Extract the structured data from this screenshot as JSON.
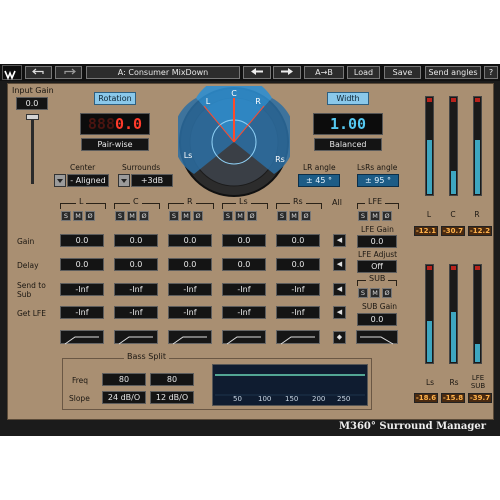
{
  "toolbar": {
    "preset_name": "A: Consumer MixDown",
    "prev_icon": "arrow-left-icon",
    "next_icon": "arrow-right-icon",
    "compare": "A→B",
    "load": "Load",
    "save": "Save",
    "send_angles": "Send angles",
    "help": "?"
  },
  "brand": {
    "product_name": "M360° Surround Manager"
  },
  "input_gain": {
    "label": "Input Gain",
    "value": "0.0"
  },
  "rotation": {
    "button": "Rotation",
    "value": "0.0",
    "mode": "Pair-wise"
  },
  "width": {
    "button": "Width",
    "value": "1.00",
    "mode": "Balanced"
  },
  "panner": {
    "labels": {
      "c": "C",
      "l": "L",
      "r": "R",
      "ls": "Ls",
      "rs": "Rs"
    }
  },
  "center": {
    "label": "Center",
    "value": "- Aligned"
  },
  "surrounds": {
    "label": "Surrounds",
    "value": "+3dB"
  },
  "lr_angle": {
    "label": "LR angle",
    "value": "± 45 °"
  },
  "lsrs_angle": {
    "label": "LsRs angle",
    "value": "± 95 °"
  },
  "channels": {
    "headers": [
      "L",
      "C",
      "R",
      "Ls",
      "Rs"
    ],
    "all_label": "All",
    "solo": "S",
    "mute": "M",
    "phase": "Ø",
    "row_labels": {
      "gain": "Gain",
      "delay": "Delay",
      "send_to_sub": "Send to Sub",
      "get_lfe": "Get LFE"
    },
    "gain": [
      "0.0",
      "0.0",
      "0.0",
      "0.0",
      "0.0"
    ],
    "delay": [
      "0.0",
      "0.0",
      "0.0",
      "0.0",
      "0.0"
    ],
    "send_to_sub": [
      "-Inf",
      "-Inf",
      "-Inf",
      "-Inf",
      "-Inf"
    ],
    "get_lfe": [
      "-Inf",
      "-Inf",
      "-Inf",
      "-Inf",
      "-Inf"
    ]
  },
  "lfe": {
    "header": "LFE",
    "gain_label": "LFE Gain",
    "gain_value": "0.0",
    "adjust_label": "LFE Adjust",
    "adjust_value": "Off"
  },
  "sub": {
    "header": "SUB",
    "gain_label": "SUB Gain",
    "gain_value": "0.0"
  },
  "bass_split": {
    "label": "Bass Split",
    "freq_label": "Freq",
    "slope_label": "Slope",
    "freq_values": [
      "80",
      "80"
    ],
    "slope_values": [
      "24 dB/O",
      "12 dB/O"
    ],
    "axis_ticks": [
      "50",
      "100",
      "150",
      "200",
      "250"
    ]
  },
  "meters_top": {
    "labels": [
      "L",
      "C",
      "R"
    ],
    "readouts": [
      "-12.1",
      "-30.7",
      "-12.2"
    ],
    "levels": [
      0.6,
      0.25,
      0.6
    ]
  },
  "meters_bottom": {
    "labels": [
      "Ls",
      "Rs",
      "LFE SUB"
    ],
    "readouts": [
      "-18.6",
      "-15.8",
      "-39.7"
    ],
    "levels": [
      0.45,
      0.55,
      0.2
    ]
  }
}
